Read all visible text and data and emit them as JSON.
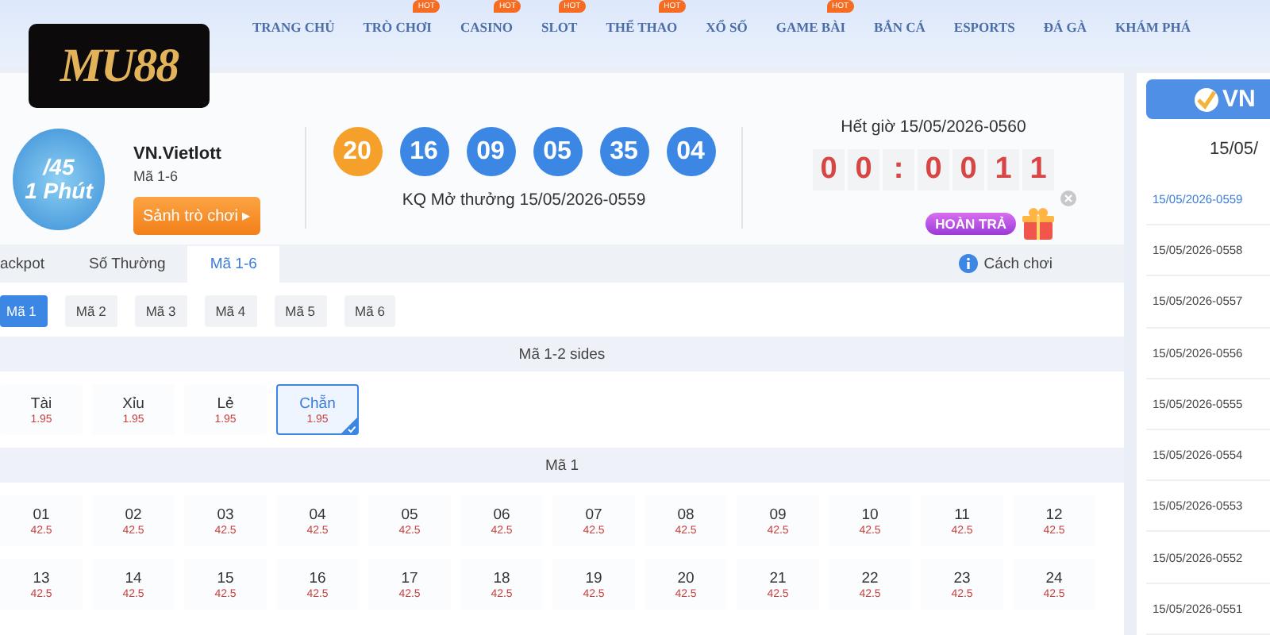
{
  "nav": {
    "items": [
      {
        "label": "TRANG CHỦ"
      },
      {
        "label": "TRÒ CHƠI",
        "badge": "HOT"
      },
      {
        "label": "CASINO",
        "badge": "HOT"
      },
      {
        "label": "SLOT",
        "badge": "HOT"
      },
      {
        "label": "THỂ THAO",
        "badge": "HOT"
      },
      {
        "label": "XỔ SỐ"
      },
      {
        "label": "GAME BÀI",
        "badge": "HOT"
      },
      {
        "label": "BẮN CÁ"
      },
      {
        "label": "ESPORTS"
      },
      {
        "label": "ĐÁ GÀ"
      },
      {
        "label": "KHÁM PHÁ"
      }
    ]
  },
  "logo": {
    "text": "MU88"
  },
  "game": {
    "icon_lines": [
      "/45",
      "1 Phút"
    ],
    "name": "VN.Vietlott",
    "subtitle": "Mã 1-6",
    "lobby_button": "Sảnh trò chơi",
    "button_arrow": "▸"
  },
  "results": {
    "balls": [
      {
        "number": "20",
        "color": "#f5a02a"
      },
      {
        "number": "16",
        "color": "#3c86e4"
      },
      {
        "number": "09",
        "color": "#3c86e4"
      },
      {
        "number": "05",
        "color": "#3c86e4"
      },
      {
        "number": "35",
        "color": "#3c86e4"
      },
      {
        "number": "04",
        "color": "#3c86e4"
      }
    ],
    "caption": "KQ Mở thưởng 15/05/2026-0559"
  },
  "countdown": {
    "label": "Hết giờ 15/05/2026-0560",
    "digits": [
      "0",
      "0",
      ":",
      "0",
      "0",
      "1",
      "1"
    ]
  },
  "promo": {
    "label": "HOÀN TRẢ"
  },
  "tabs": [
    {
      "label": "ackpot",
      "selected": false
    },
    {
      "label": "Số Thường",
      "selected": false
    },
    {
      "label": "Mã 1-6",
      "selected": true
    }
  ],
  "help": "Cách chơi",
  "subtabs": [
    {
      "label": "Mã 1",
      "selected": true
    },
    {
      "label": "Mã 2",
      "selected": false
    },
    {
      "label": "Mã 3",
      "selected": false
    },
    {
      "label": "Mã 4",
      "selected": false
    },
    {
      "label": "Mã 5",
      "selected": false
    },
    {
      "label": "Mã 6",
      "selected": false
    }
  ],
  "sections": [
    {
      "title": "Mã 1-2 sides",
      "options": [
        {
          "label": "Tài",
          "odds": "1.95",
          "selected": false
        },
        {
          "label": "Xỉu",
          "odds": "1.95",
          "selected": false
        },
        {
          "label": "Lẻ",
          "odds": "1.95",
          "selected": false
        },
        {
          "label": "Chẵn",
          "odds": "1.95",
          "selected": true
        }
      ]
    },
    {
      "title": "Mã 1",
      "options": [
        {
          "label": "01",
          "odds": "42.5",
          "selected": false
        },
        {
          "label": "02",
          "odds": "42.5",
          "selected": false
        },
        {
          "label": "03",
          "odds": "42.5",
          "selected": false
        },
        {
          "label": "04",
          "odds": "42.5",
          "selected": false
        },
        {
          "label": "05",
          "odds": "42.5",
          "selected": false
        },
        {
          "label": "06",
          "odds": "42.5",
          "selected": false
        },
        {
          "label": "07",
          "odds": "42.5",
          "selected": false
        },
        {
          "label": "08",
          "odds": "42.5",
          "selected": false
        },
        {
          "label": "09",
          "odds": "42.5",
          "selected": false
        },
        {
          "label": "10",
          "odds": "42.5",
          "selected": false
        },
        {
          "label": "11",
          "odds": "42.5",
          "selected": false
        },
        {
          "label": "12",
          "odds": "42.5",
          "selected": false
        },
        {
          "label": "13",
          "odds": "42.5",
          "selected": false
        },
        {
          "label": "14",
          "odds": "42.5",
          "selected": false
        },
        {
          "label": "15",
          "odds": "42.5",
          "selected": false
        },
        {
          "label": "16",
          "odds": "42.5",
          "selected": false
        },
        {
          "label": "17",
          "odds": "42.5",
          "selected": false
        },
        {
          "label": "18",
          "odds": "42.5",
          "selected": false
        },
        {
          "label": "19",
          "odds": "42.5",
          "selected": false
        },
        {
          "label": "20",
          "odds": "42.5",
          "selected": false
        },
        {
          "label": "21",
          "odds": "42.5",
          "selected": false
        },
        {
          "label": "22",
          "odds": "42.5",
          "selected": false
        },
        {
          "label": "23",
          "odds": "42.5",
          "selected": false
        },
        {
          "label": "24",
          "odds": "42.5",
          "selected": false
        }
      ]
    }
  ],
  "sidebar": {
    "brand": "VN",
    "date": "15/05/",
    "draws": [
      {
        "label": "15/05/2026-0559",
        "selected": true
      },
      {
        "label": "15/05/2026-0558",
        "selected": false
      },
      {
        "label": "15/05/2026-0557",
        "selected": false
      },
      {
        "label": "15/05/2026-0556",
        "selected": false
      },
      {
        "label": "15/05/2026-0555",
        "selected": false
      },
      {
        "label": "15/05/2026-0554",
        "selected": false
      },
      {
        "label": "15/05/2026-0553",
        "selected": false
      },
      {
        "label": "15/05/2026-0552",
        "selected": false
      },
      {
        "label": "15/05/2026-0551",
        "selected": false
      }
    ]
  }
}
